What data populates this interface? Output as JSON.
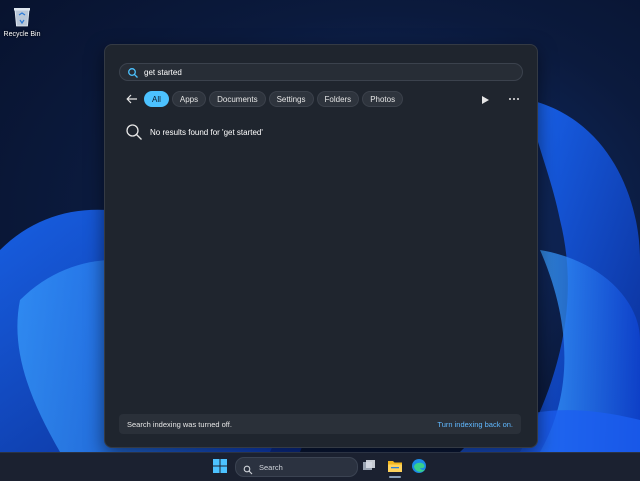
{
  "desktop": {
    "icons": [
      {
        "label": "Recycle Bin",
        "icon": "recycle-bin-icon"
      }
    ]
  },
  "search_panel": {
    "query": "get started",
    "filters": [
      "All",
      "Apps",
      "Documents",
      "Settings",
      "Folders",
      "Photos"
    ],
    "active_filter": "All",
    "no_results_text": "No results found for 'get started'",
    "index_message": "Search indexing was turned off.",
    "index_link": "Turn indexing back on."
  },
  "taskbar": {
    "search_label": "Search",
    "icons": [
      "windows-start-icon",
      "search-icon",
      "task-view-icon",
      "file-explorer-icon",
      "edge-icon"
    ]
  },
  "colors": {
    "accent": "#4cc2ff",
    "link": "#60b8ff",
    "panel_bg": "#1f252e"
  }
}
